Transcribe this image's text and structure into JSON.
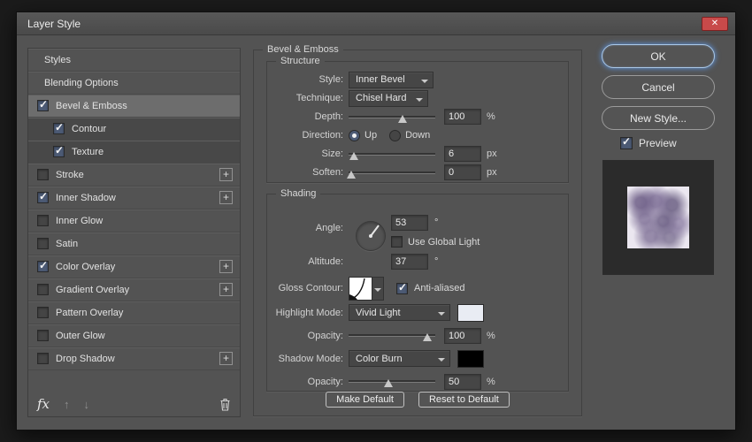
{
  "window": {
    "title": "Layer Style"
  },
  "icons": {
    "close": "✕",
    "fx": "fx",
    "up_arrow": "↑",
    "down_arrow": "↓"
  },
  "sidebar": {
    "items": [
      {
        "label": "Styles"
      },
      {
        "label": "Blending Options"
      },
      {
        "label": "Bevel & Emboss",
        "checked": true,
        "selected": true
      },
      {
        "label": "Contour",
        "checked": true,
        "indent": true
      },
      {
        "label": "Texture",
        "checked": true,
        "indent": true
      },
      {
        "label": "Stroke",
        "checked": false,
        "plus": true
      },
      {
        "label": "Inner Shadow",
        "checked": true,
        "plus": true
      },
      {
        "label": "Inner Glow",
        "checked": false
      },
      {
        "label": "Satin",
        "checked": false
      },
      {
        "label": "Color Overlay",
        "checked": true,
        "plus": true
      },
      {
        "label": "Gradient Overlay",
        "checked": false,
        "plus": true
      },
      {
        "label": "Pattern Overlay",
        "checked": false
      },
      {
        "label": "Outer Glow",
        "checked": false
      },
      {
        "label": "Drop Shadow",
        "checked": false,
        "plus": true
      }
    ]
  },
  "panel": {
    "title": "Bevel & Emboss",
    "structure": {
      "legend": "Structure",
      "style": {
        "label": "Style:",
        "value": "Inner Bevel"
      },
      "technique": {
        "label": "Technique:",
        "value": "Chisel Hard"
      },
      "depth": {
        "label": "Depth:",
        "value": "100",
        "unit": "%"
      },
      "direction": {
        "label": "Direction:",
        "up": "Up",
        "down": "Down",
        "up_selected": true,
        "down_selected": false
      },
      "size": {
        "label": "Size:",
        "value": "6",
        "unit": "px"
      },
      "soften": {
        "label": "Soften:",
        "value": "0",
        "unit": "px"
      }
    },
    "shading": {
      "legend": "Shading",
      "angle": {
        "label": "Angle:",
        "value": "53",
        "unit": "°"
      },
      "use_global_light": {
        "label": "Use Global Light",
        "checked": false
      },
      "altitude": {
        "label": "Altitude:",
        "value": "37",
        "unit": "°"
      },
      "gloss_contour": {
        "label": "Gloss Contour:"
      },
      "anti_aliased": {
        "label": "Anti-aliased",
        "checked": true
      },
      "highlight_mode": {
        "label": "Highlight Mode:",
        "value": "Vivid Light",
        "swatch": "#e9ecf3"
      },
      "highlight_opacity": {
        "label": "Opacity:",
        "value": "100",
        "unit": "%"
      },
      "shadow_mode": {
        "label": "Shadow Mode:",
        "value": "Color Burn",
        "swatch": "#000000"
      },
      "shadow_opacity": {
        "label": "Opacity:",
        "value": "50",
        "unit": "%"
      }
    },
    "footer": {
      "make_default": "Make Default",
      "reset_to_default": "Reset to Default"
    }
  },
  "actions": {
    "ok": "OK",
    "cancel": "Cancel",
    "new_style": "New Style...",
    "preview": {
      "label": "Preview",
      "checked": true
    }
  }
}
